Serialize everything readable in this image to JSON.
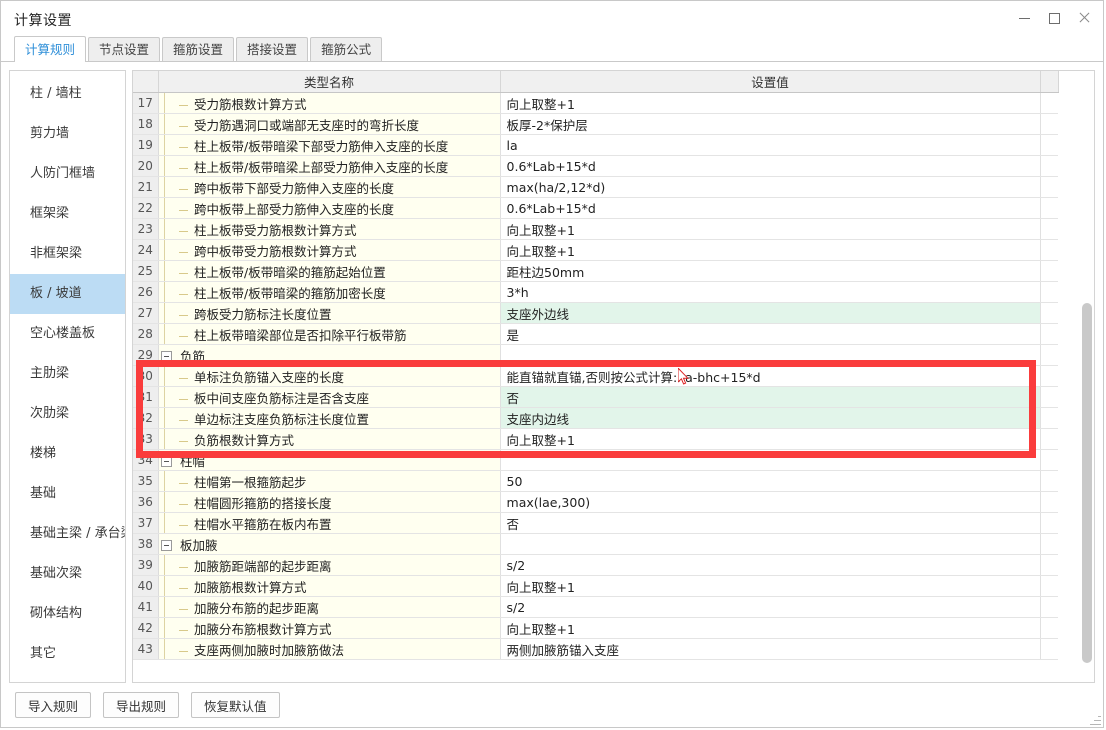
{
  "window": {
    "title": "计算设置",
    "controls": [
      {
        "name": "minimize-button",
        "glyph": "minimize"
      },
      {
        "name": "maximize-button",
        "glyph": "maximize"
      },
      {
        "name": "close-button",
        "glyph": "close"
      }
    ]
  },
  "tabs": [
    {
      "label": "计算规则",
      "active": true
    },
    {
      "label": "节点设置",
      "active": false
    },
    {
      "label": "箍筋设置",
      "active": false
    },
    {
      "label": "搭接设置",
      "active": false
    },
    {
      "label": "箍筋公式",
      "active": false
    }
  ],
  "sidebar": {
    "items": [
      {
        "label": "柱 / 墙柱",
        "selected": false
      },
      {
        "label": "剪力墙",
        "selected": false
      },
      {
        "label": "人防门框墙",
        "selected": false
      },
      {
        "label": "框架梁",
        "selected": false
      },
      {
        "label": "非框架梁",
        "selected": false
      },
      {
        "label": "板 / 坡道",
        "selected": true
      },
      {
        "label": "空心楼盖板",
        "selected": false
      },
      {
        "label": "主肋梁",
        "selected": false
      },
      {
        "label": "次肋梁",
        "selected": false
      },
      {
        "label": "楼梯",
        "selected": false
      },
      {
        "label": "基础",
        "selected": false
      },
      {
        "label": "基础主梁 / 承台梁",
        "selected": false
      },
      {
        "label": "基础次梁",
        "selected": false
      },
      {
        "label": "砌体结构",
        "selected": false
      },
      {
        "label": "其它",
        "selected": false
      }
    ]
  },
  "table": {
    "headers": {
      "row_number": "",
      "tree": "",
      "name": "类型名称",
      "value": "设置值"
    },
    "rows": [
      {
        "n": "17",
        "type": "leaf",
        "name": "受力筋根数计算方式",
        "value": "向上取整+1",
        "highlight": false
      },
      {
        "n": "18",
        "type": "leaf",
        "name": "受力筋遇洞口或端部无支座时的弯折长度",
        "value": "板厚-2*保护层",
        "highlight": false
      },
      {
        "n": "19",
        "type": "leaf",
        "name": "柱上板带/板带暗梁下部受力筋伸入支座的长度",
        "value": "la",
        "highlight": false
      },
      {
        "n": "20",
        "type": "leaf",
        "name": "柱上板带/板带暗梁上部受力筋伸入支座的长度",
        "value": "0.6*Lab+15*d",
        "highlight": false
      },
      {
        "n": "21",
        "type": "leaf",
        "name": "跨中板带下部受力筋伸入支座的长度",
        "value": "max(ha/2,12*d)",
        "highlight": false
      },
      {
        "n": "22",
        "type": "leaf",
        "name": "跨中板带上部受力筋伸入支座的长度",
        "value": "0.6*Lab+15*d",
        "highlight": false
      },
      {
        "n": "23",
        "type": "leaf",
        "name": "柱上板带受力筋根数计算方式",
        "value": "向上取整+1",
        "highlight": false
      },
      {
        "n": "24",
        "type": "leaf",
        "name": "跨中板带受力筋根数计算方式",
        "value": "向上取整+1",
        "highlight": false
      },
      {
        "n": "25",
        "type": "leaf",
        "name": "柱上板带/板带暗梁的箍筋起始位置",
        "value": "距柱边50mm",
        "highlight": false
      },
      {
        "n": "26",
        "type": "leaf",
        "name": "柱上板带/板带暗梁的箍筋加密长度",
        "value": "3*h",
        "highlight": false
      },
      {
        "n": "27",
        "type": "leaf",
        "name": "跨板受力筋标注长度位置",
        "value": "支座外边线",
        "highlight": true
      },
      {
        "n": "28",
        "type": "leaf",
        "name": "柱上板带暗梁部位是否扣除平行板带筋",
        "value": "是",
        "highlight": false
      },
      {
        "n": "29",
        "type": "group",
        "name": "负筋",
        "value": "",
        "highlight": false
      },
      {
        "n": "30",
        "type": "leaf",
        "name": "单标注负筋锚入支座的长度",
        "value": "能直锚就直锚,否则按公式计算:ha-bhc+15*d",
        "highlight": false
      },
      {
        "n": "31",
        "type": "leaf",
        "name": "板中间支座负筋标注是否含支座",
        "value": "否",
        "highlight": true
      },
      {
        "n": "32",
        "type": "leaf",
        "name": "单边标注支座负筋标注长度位置",
        "value": "支座内边线",
        "highlight": true
      },
      {
        "n": "33",
        "type": "leaf",
        "name": "负筋根数计算方式",
        "value": "向上取整+1",
        "highlight": false
      },
      {
        "n": "34",
        "type": "group",
        "name": "柱帽",
        "value": "",
        "highlight": false
      },
      {
        "n": "35",
        "type": "leaf",
        "name": "柱帽第一根箍筋起步",
        "value": "50",
        "highlight": false
      },
      {
        "n": "36",
        "type": "leaf",
        "name": "柱帽圆形箍筋的搭接长度",
        "value": "max(lae,300)",
        "highlight": false
      },
      {
        "n": "37",
        "type": "leaf",
        "name": "柱帽水平箍筋在板内布置",
        "value": "否",
        "highlight": false
      },
      {
        "n": "38",
        "type": "group",
        "name": "板加腋",
        "value": "",
        "highlight": false
      },
      {
        "n": "39",
        "type": "leaf",
        "name": "加腋筋距端部的起步距离",
        "value": "s/2",
        "highlight": false
      },
      {
        "n": "40",
        "type": "leaf",
        "name": "加腋筋根数计算方式",
        "value": "向上取整+1",
        "highlight": false
      },
      {
        "n": "41",
        "type": "leaf",
        "name": "加腋分布筋的起步距离",
        "value": "s/2",
        "highlight": false
      },
      {
        "n": "42",
        "type": "leaf",
        "name": "加腋分布筋根数计算方式",
        "value": "向上取整+1",
        "highlight": false
      },
      {
        "n": "43",
        "type": "leaf",
        "name": "支座两侧加腋时加腋筋做法",
        "value": "两侧加腋筋锚入支座",
        "highlight": false
      }
    ]
  },
  "annotation": {
    "box_color": "#fa3c3c",
    "covers_rows": [
      "30",
      "31",
      "32",
      "33"
    ]
  },
  "footer": {
    "buttons": [
      {
        "label": "导入规则",
        "name": "import-rules-button"
      },
      {
        "label": "导出规则",
        "name": "export-rules-button"
      },
      {
        "label": "恢复默认值",
        "name": "restore-defaults-button"
      }
    ]
  },
  "colors": {
    "selected_sidebar": "#bcdcf4",
    "active_tab_text": "#2f8fd8",
    "highlight_cell": "#e2f5ea",
    "name_column_bg": "#fffff0"
  }
}
